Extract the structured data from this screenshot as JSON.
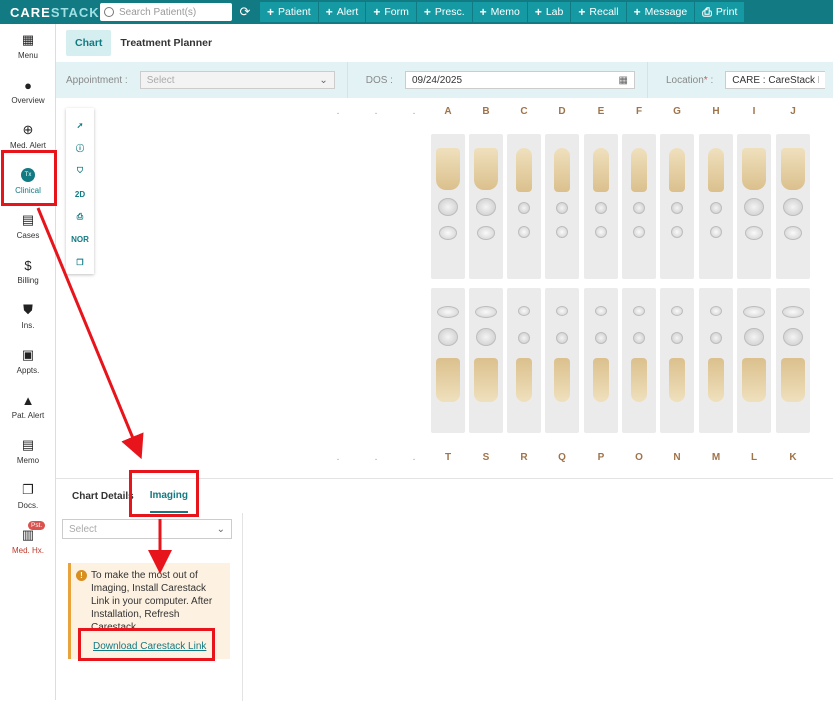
{
  "topbar": {
    "logo_a": "CARE",
    "logo_b": "STACK",
    "search_placeholder": "Search Patient(s)",
    "buttons": [
      {
        "label": "Patient",
        "prefix": "+"
      },
      {
        "label": "Alert",
        "prefix": "+"
      },
      {
        "label": "Form",
        "prefix": "+"
      },
      {
        "label": "Presc.",
        "prefix": "+"
      },
      {
        "label": "Memo",
        "prefix": "+"
      },
      {
        "label": "Lab",
        "prefix": "+"
      },
      {
        "label": "Recall",
        "prefix": "+"
      },
      {
        "label": "Message",
        "prefix": "+"
      },
      {
        "label": "Print",
        "prefix": "⎙"
      }
    ]
  },
  "leftnav": {
    "items": [
      {
        "label": "Menu",
        "icon": "grid-icon"
      },
      {
        "label": "Overview",
        "icon": "person-icon"
      },
      {
        "label": "Med. Alert",
        "icon": "plus-circle-icon"
      },
      {
        "label": "Clinical",
        "icon": "tx-icon",
        "icon_text": "Tx"
      },
      {
        "label": "Cases",
        "icon": "clipboard-icon"
      },
      {
        "label": "Billing",
        "icon": "dollar-doc-icon"
      },
      {
        "label": "Ins.",
        "icon": "shield-icon"
      },
      {
        "label": "Appts.",
        "icon": "calendar-icon"
      },
      {
        "label": "Pat. Alert",
        "icon": "warning-icon"
      },
      {
        "label": "Memo",
        "icon": "memo-icon"
      },
      {
        "label": "Docs.",
        "icon": "documents-icon"
      },
      {
        "label": "Med. Hx.",
        "icon": "medical-history-icon",
        "badge": "Pst."
      }
    ]
  },
  "tabs": [
    {
      "label": "Chart"
    },
    {
      "label": "Treatment Planner"
    }
  ],
  "filters": {
    "appointment_label": "Appointment",
    "appointment_placeholder": "Select",
    "dos_label": "DOS",
    "dos_value": "09/24/2025",
    "location_label": "Location",
    "location_value": "CARE : CareStack D"
  },
  "chart": {
    "tools": [
      "pointer-icon",
      "info-icon",
      "tooth-icon",
      "2D",
      "printer-icon",
      "NOR",
      "copy-icon"
    ],
    "upper_letters": [
      "A",
      "B",
      "C",
      "D",
      "E",
      "F",
      "G",
      "H",
      "I",
      "J"
    ],
    "lower_letters": [
      "T",
      "S",
      "R",
      "Q",
      "P",
      "O",
      "N",
      "M",
      "L",
      "K"
    ],
    "dots": [
      ".",
      ".",
      "."
    ]
  },
  "bottom": {
    "tabs": [
      {
        "label": "Chart Details"
      },
      {
        "label": "Imaging"
      }
    ],
    "select_placeholder": "Select",
    "alert_text": "To make the most out of Imaging, Install Carestack Link in your computer. After Installation, Refresh Carestack",
    "download_link": "Download Carestack Link"
  },
  "colors": {
    "brand": "#127a82",
    "annotation_red": "#e8141c",
    "tooth_label": "#a0744a"
  }
}
